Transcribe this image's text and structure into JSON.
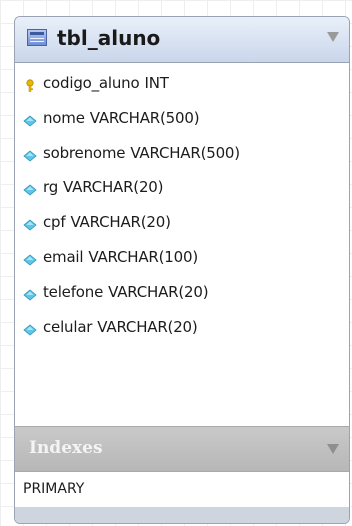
{
  "table": {
    "name": "tbl_aluno",
    "columns": [
      {
        "name": "codigo_aluno",
        "type": "INT",
        "icon": "primary-key-icon"
      },
      {
        "name": "nome",
        "type": "VARCHAR(500)",
        "icon": "column-diamond-icon"
      },
      {
        "name": "sobrenome",
        "type": "VARCHAR(500)",
        "icon": "column-diamond-icon"
      },
      {
        "name": "rg",
        "type": "VARCHAR(20)",
        "icon": "column-diamond-icon"
      },
      {
        "name": "cpf",
        "type": "VARCHAR(20)",
        "icon": "column-diamond-icon"
      },
      {
        "name": "email",
        "type": "VARCHAR(100)",
        "icon": "column-diamond-icon"
      },
      {
        "name": "telefone",
        "type": "VARCHAR(20)",
        "icon": "column-diamond-icon"
      },
      {
        "name": "celular",
        "type": "VARCHAR(20)",
        "icon": "column-diamond-icon"
      }
    ],
    "indexes_label": "Indexes",
    "indexes": [
      "PRIMARY"
    ]
  },
  "colors": {
    "header_gradient_top": "#e9f0fa",
    "header_gradient_bottom": "#c9d6ea",
    "diamond": "#5fc6e8",
    "key": "#e8b800",
    "indexes_header": "#bdbdbd"
  }
}
